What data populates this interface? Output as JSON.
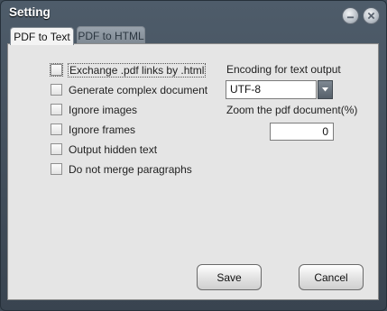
{
  "window": {
    "title": "Setting"
  },
  "tabs": [
    {
      "label": "PDF to Text",
      "active": true
    },
    {
      "label": "PDF to HTML",
      "active": false
    }
  ],
  "options": [
    {
      "label": "Exchange .pdf links by .html",
      "checked": false
    },
    {
      "label": "Generate complex document",
      "checked": false
    },
    {
      "label": "Ignore images",
      "checked": false
    },
    {
      "label": "Ignore frames",
      "checked": false
    },
    {
      "label": "Output hidden text",
      "checked": false
    },
    {
      "label": "Do not merge paragraphs",
      "checked": false
    }
  ],
  "encoding": {
    "label": "Encoding for text output",
    "value": "UTF-8"
  },
  "zoom": {
    "label": "Zoom the pdf document(%)",
    "value": "0"
  },
  "buttons": {
    "save": "Save",
    "cancel": "Cancel"
  },
  "icons": {
    "minimize": "minimize-icon",
    "close": "close-icon",
    "dropdown": "chevron-down-icon"
  }
}
